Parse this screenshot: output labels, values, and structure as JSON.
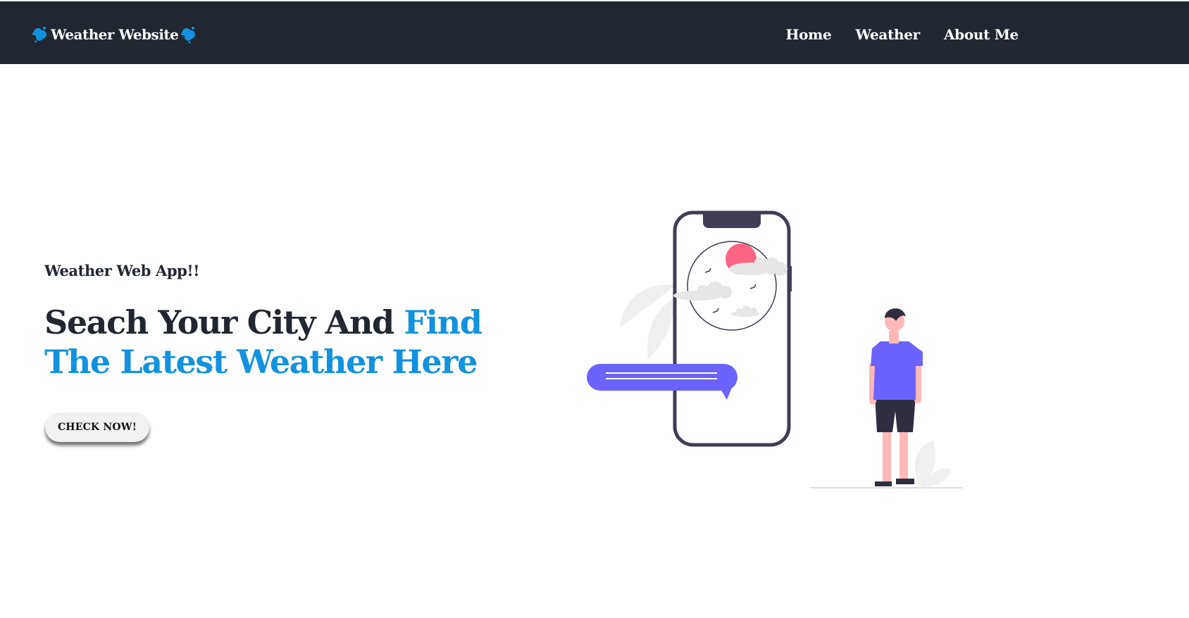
{
  "navbar": {
    "brand": {
      "label": "Weather Website",
      "left_icon": "cloud-icon",
      "right_icon": "cloud-icon",
      "color": "#1292de"
    },
    "links": [
      {
        "label": "Home"
      },
      {
        "label": "Weather"
      },
      {
        "label": "About Me"
      }
    ],
    "background": "#212730"
  },
  "hero": {
    "eyebrow": "Weather Web App!!",
    "headline_plain": "Seach Your City And",
    "headline_accent": "Find The Latest Weather Here",
    "accent_color": "#1292de",
    "cta_label": "CHECK NOW!"
  },
  "illustration": {
    "description_icon": "person-with-phone-weather-illustration",
    "colors": {
      "phone_frame": "#3f3d56",
      "sun": "#ff6584",
      "bubble": "#6c63ff",
      "shirt": "#6c63ff",
      "skin": "#ffb8b8",
      "cloud": "#e6e6e6"
    }
  }
}
